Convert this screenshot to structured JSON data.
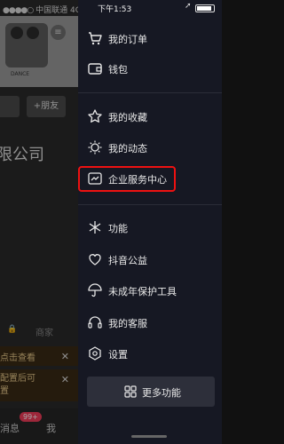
{
  "background_app": {
    "carrier": "中国联通",
    "network": "4G",
    "hero_caption": "DANCE",
    "add_friend_label": "+朋友",
    "company_text": "限公司",
    "shop_tab": "商家",
    "banner1_text": "点击查看",
    "banner2_text": "配置后可\n置",
    "messages_label": "消息",
    "messages_badge": "99+",
    "me_label": "我"
  },
  "drawer": {
    "time": "下午1:53",
    "menu": [
      {
        "label": "我的订单",
        "icon": "cart-icon"
      },
      {
        "label": "钱包",
        "icon": "wallet-icon"
      },
      {
        "label": "我的收藏",
        "icon": "star-icon"
      },
      {
        "label": "我的动态",
        "icon": "sun-icon"
      },
      {
        "label": "企业服务中心",
        "icon": "chart-icon"
      },
      {
        "label": "功能",
        "icon": "sparkle-icon"
      },
      {
        "label": "抖音公益",
        "icon": "heart-icon"
      },
      {
        "label": "未成年保护工具",
        "icon": "umbrella-icon"
      },
      {
        "label": "我的客服",
        "icon": "headset-icon"
      },
      {
        "label": "设置",
        "icon": "gear-icon"
      }
    ],
    "more_button": "更多功能"
  },
  "colors": {
    "drawer_bg": "#161823",
    "highlight": "#e11111",
    "badge": "#f23c5a"
  }
}
